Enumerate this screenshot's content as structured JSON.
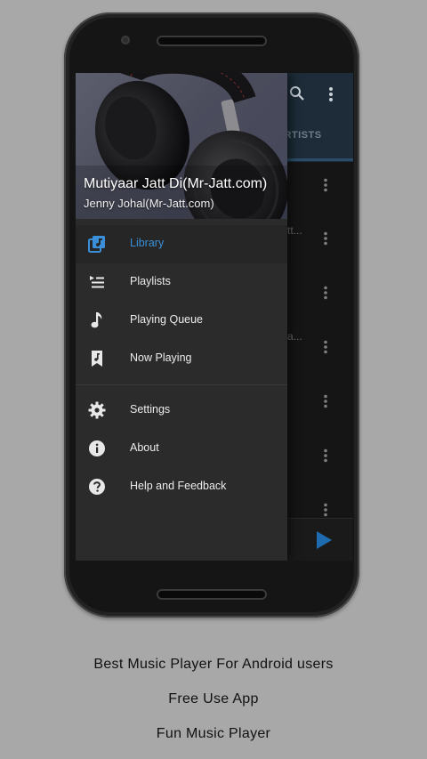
{
  "now_playing": {
    "title": "Mutiyaar Jatt Di(Mr-Jatt.com)",
    "artist": "Jenny Johal(Mr-Jatt.com)"
  },
  "background_app": {
    "tab_label": "ARTISTS",
    "row_fragments": [
      "tt...",
      "a..."
    ]
  },
  "drawer": {
    "items": [
      {
        "label": "Library",
        "icon": "library-icon",
        "active": true
      },
      {
        "label": "Playlists",
        "icon": "playlist-icon",
        "active": false
      },
      {
        "label": "Playing Queue",
        "icon": "music-note-icon",
        "active": false
      },
      {
        "label": "Now Playing",
        "icon": "bookmark-music-icon",
        "active": false
      },
      {
        "label": "Settings",
        "icon": "gear-icon",
        "active": false
      },
      {
        "label": "About",
        "icon": "info-icon",
        "active": false
      },
      {
        "label": "Help and Feedback",
        "icon": "help-icon",
        "active": false
      }
    ]
  },
  "captions": [
    "Best Music Player For Android users",
    "Free Use App",
    "Fun Music Player"
  ],
  "colors": {
    "accent": "#3a8fd8",
    "play_button": "#1e6bb0",
    "page_background": "#a8a8a8"
  }
}
